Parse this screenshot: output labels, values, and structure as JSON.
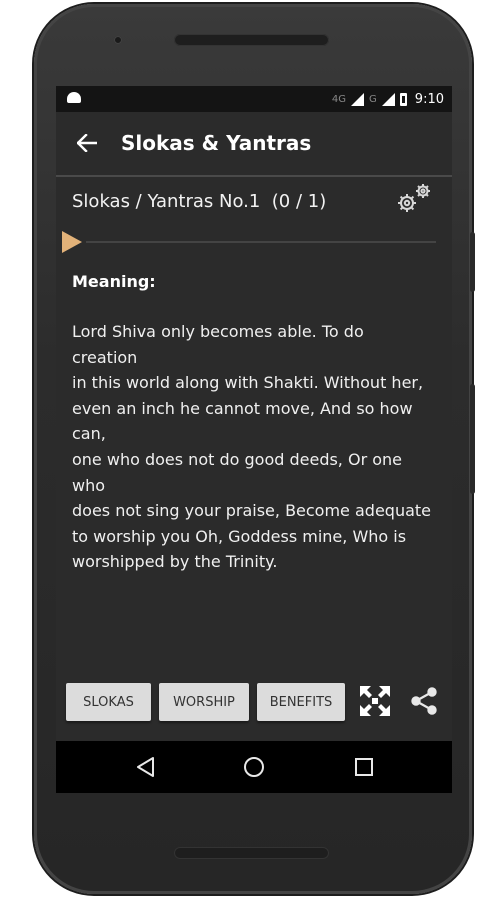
{
  "status_bar": {
    "network_1": "4G",
    "network_2": "G",
    "time": "9:10"
  },
  "app_bar": {
    "title": "Slokas & Yantras",
    "back_icon": "arrow-left-icon"
  },
  "content": {
    "header": "Slokas / Yantras No.1  (0 / 1)",
    "settings_icon": "gears-icon",
    "play_icon": "play-icon",
    "meaning_label": "Meaning:",
    "meaning_lines": [
      "Lord Shiva only becomes able. To do creation",
      "in this world along with Shakti. Without her,",
      "even an inch he cannot move, And so how can,",
      "one who does not do good deeds, Or one who",
      "does not sing your praise, Become adequate",
      "to worship you Oh, Goddess mine, Who is",
      "worshipped by the Trinity."
    ]
  },
  "bottom_bar": {
    "buttons": [
      "SLOKAS",
      "WORSHIP",
      "BENEFITS"
    ],
    "grid_icon": "fullscreen-arrows-icon",
    "share_icon": "share-icon"
  },
  "nav_bar": {
    "back_icon": "nav-back-icon",
    "home_icon": "nav-home-icon",
    "recent_icon": "nav-recents-icon"
  },
  "colors": {
    "screen_bg": "#2b2b2b",
    "accent_play": "#e2b279",
    "button_bg": "#dcdcdc"
  }
}
